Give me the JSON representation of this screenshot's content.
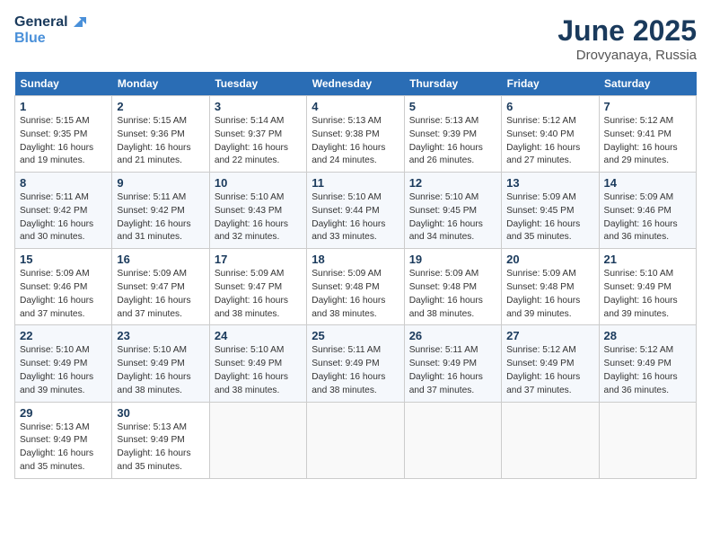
{
  "logo": {
    "line1": "General",
    "line2": "Blue"
  },
  "title": "June 2025",
  "location": "Drovyanaya, Russia",
  "weekdays": [
    "Sunday",
    "Monday",
    "Tuesday",
    "Wednesday",
    "Thursday",
    "Friday",
    "Saturday"
  ],
  "weeks": [
    [
      {
        "day": 1,
        "sunrise": "5:15 AM",
        "sunset": "9:35 PM",
        "daylight": "16 hours and 19 minutes."
      },
      {
        "day": 2,
        "sunrise": "5:15 AM",
        "sunset": "9:36 PM",
        "daylight": "16 hours and 21 minutes."
      },
      {
        "day": 3,
        "sunrise": "5:14 AM",
        "sunset": "9:37 PM",
        "daylight": "16 hours and 22 minutes."
      },
      {
        "day": 4,
        "sunrise": "5:13 AM",
        "sunset": "9:38 PM",
        "daylight": "16 hours and 24 minutes."
      },
      {
        "day": 5,
        "sunrise": "5:13 AM",
        "sunset": "9:39 PM",
        "daylight": "16 hours and 26 minutes."
      },
      {
        "day": 6,
        "sunrise": "5:12 AM",
        "sunset": "9:40 PM",
        "daylight": "16 hours and 27 minutes."
      },
      {
        "day": 7,
        "sunrise": "5:12 AM",
        "sunset": "9:41 PM",
        "daylight": "16 hours and 29 minutes."
      }
    ],
    [
      {
        "day": 8,
        "sunrise": "5:11 AM",
        "sunset": "9:42 PM",
        "daylight": "16 hours and 30 minutes."
      },
      {
        "day": 9,
        "sunrise": "5:11 AM",
        "sunset": "9:42 PM",
        "daylight": "16 hours and 31 minutes."
      },
      {
        "day": 10,
        "sunrise": "5:10 AM",
        "sunset": "9:43 PM",
        "daylight": "16 hours and 32 minutes."
      },
      {
        "day": 11,
        "sunrise": "5:10 AM",
        "sunset": "9:44 PM",
        "daylight": "16 hours and 33 minutes."
      },
      {
        "day": 12,
        "sunrise": "5:10 AM",
        "sunset": "9:45 PM",
        "daylight": "16 hours and 34 minutes."
      },
      {
        "day": 13,
        "sunrise": "5:09 AM",
        "sunset": "9:45 PM",
        "daylight": "16 hours and 35 minutes."
      },
      {
        "day": 14,
        "sunrise": "5:09 AM",
        "sunset": "9:46 PM",
        "daylight": "16 hours and 36 minutes."
      }
    ],
    [
      {
        "day": 15,
        "sunrise": "5:09 AM",
        "sunset": "9:46 PM",
        "daylight": "16 hours and 37 minutes."
      },
      {
        "day": 16,
        "sunrise": "5:09 AM",
        "sunset": "9:47 PM",
        "daylight": "16 hours and 37 minutes."
      },
      {
        "day": 17,
        "sunrise": "5:09 AM",
        "sunset": "9:47 PM",
        "daylight": "16 hours and 38 minutes."
      },
      {
        "day": 18,
        "sunrise": "5:09 AM",
        "sunset": "9:48 PM",
        "daylight": "16 hours and 38 minutes."
      },
      {
        "day": 19,
        "sunrise": "5:09 AM",
        "sunset": "9:48 PM",
        "daylight": "16 hours and 38 minutes."
      },
      {
        "day": 20,
        "sunrise": "5:09 AM",
        "sunset": "9:48 PM",
        "daylight": "16 hours and 39 minutes."
      },
      {
        "day": 21,
        "sunrise": "5:10 AM",
        "sunset": "9:49 PM",
        "daylight": "16 hours and 39 minutes."
      }
    ],
    [
      {
        "day": 22,
        "sunrise": "5:10 AM",
        "sunset": "9:49 PM",
        "daylight": "16 hours and 39 minutes."
      },
      {
        "day": 23,
        "sunrise": "5:10 AM",
        "sunset": "9:49 PM",
        "daylight": "16 hours and 38 minutes."
      },
      {
        "day": 24,
        "sunrise": "5:10 AM",
        "sunset": "9:49 PM",
        "daylight": "16 hours and 38 minutes."
      },
      {
        "day": 25,
        "sunrise": "5:11 AM",
        "sunset": "9:49 PM",
        "daylight": "16 hours and 38 minutes."
      },
      {
        "day": 26,
        "sunrise": "5:11 AM",
        "sunset": "9:49 PM",
        "daylight": "16 hours and 37 minutes."
      },
      {
        "day": 27,
        "sunrise": "5:12 AM",
        "sunset": "9:49 PM",
        "daylight": "16 hours and 37 minutes."
      },
      {
        "day": 28,
        "sunrise": "5:12 AM",
        "sunset": "9:49 PM",
        "daylight": "16 hours and 36 minutes."
      }
    ],
    [
      {
        "day": 29,
        "sunrise": "5:13 AM",
        "sunset": "9:49 PM",
        "daylight": "16 hours and 35 minutes."
      },
      {
        "day": 30,
        "sunrise": "5:13 AM",
        "sunset": "9:49 PM",
        "daylight": "16 hours and 35 minutes."
      },
      null,
      null,
      null,
      null,
      null
    ]
  ]
}
